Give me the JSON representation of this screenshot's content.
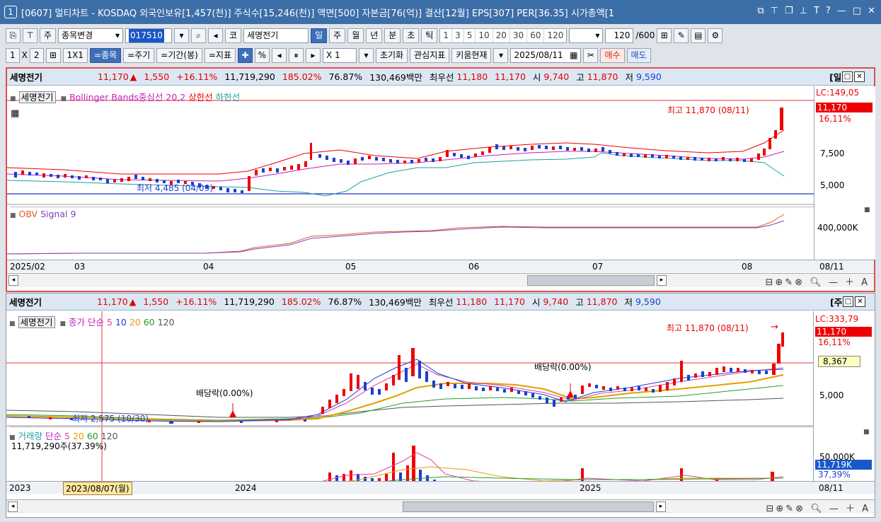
{
  "window": {
    "num": "1",
    "title": "[0607] 멀티차트 - KOSDAQ 외국인보유[1,457(천)] 주식수[15,246(천)] 액면[500] 자본금[76(억)] 결산[12월] EPS[307] PER[36.35] 시가총액[1"
  },
  "toolbar1": {
    "market": "주",
    "combo": "종목변경",
    "code": "017510",
    "market2": "코",
    "stock_name": "세명전기",
    "periods": [
      "일",
      "주",
      "월",
      "년",
      "분",
      "초",
      "틱"
    ],
    "nums": [
      "1",
      "3",
      "5",
      "10",
      "20",
      "30",
      "60",
      "120"
    ],
    "count": "120",
    "total": "/600"
  },
  "toolbar2": {
    "one": "1",
    "x": "X",
    "two": "2",
    "layout": "1X1",
    "b1": "=종목",
    "b2": "=주기",
    "b3": "=기간(봉)",
    "b4": "=지표",
    "mult": "X 1",
    "reset": "초기화",
    "interest": "관심지표",
    "kiwoom": "키움현재",
    "date": "2025/08/11",
    "buy": "매수",
    "sell": "매도"
  },
  "panel1": {
    "info": {
      "name": "세명전기",
      "price": "11,170",
      "arrow": "▲",
      "change": "1,550",
      "pct": "+16.11%",
      "volume": "11,719,290",
      "vr": "185.02%",
      "turn": "76.87%",
      "amount": "130,469백만",
      "best_label": "최우선",
      "best1": "11,180",
      "best2": "11,170",
      "open_l": "시",
      "open": "9,740",
      "high_l": "고",
      "high": "11,870",
      "low_l": "저",
      "low": "9,590",
      "period": "[일]"
    },
    "legend": {
      "name": "세명전기",
      "ind": "Bollinger Bands중심선 20,2",
      "up": "상한선",
      "down": "하한선"
    },
    "tags": {
      "high": "최고 11,870 (08/11)",
      "low": "최저 4,485 (04/09)"
    },
    "axis": {
      "lc": "LC:149,05",
      "cur": "11,170",
      "cur_pct": "16,11%",
      "l1": "7,500",
      "l2": "5,000",
      "obv": "400,000K"
    },
    "legend2": {
      "a": "OBV",
      "b": "Signal 9"
    },
    "dates": [
      "2025/02",
      "03",
      "04",
      "05",
      "06",
      "07",
      "08"
    ],
    "date_right": "08/11"
  },
  "panel2": {
    "info": {
      "name": "세명전기",
      "price": "11,170",
      "arrow": "▲",
      "change": "1,550",
      "pct": "+16.11%",
      "volume": "11,719,290",
      "vr": "185.02%",
      "turn": "76.87%",
      "amount": "130,469백만",
      "best_label": "최우선",
      "best1": "11,180",
      "best2": "11,170",
      "open_l": "시",
      "open": "9,740",
      "high_l": "고",
      "high": "11,870",
      "low_l": "저",
      "low": "9,590",
      "period": "[주]"
    },
    "legend": {
      "name": "세명전기",
      "a": "종가",
      "b": "단순",
      "m5": "5",
      "m10": "10",
      "m20": "20",
      "m60": "60",
      "m120": "120"
    },
    "tags": {
      "high": "최고 11,870 (08/11)",
      "low": "최저 2,575 (10/30)",
      "div1": "배당락(0.00%)",
      "div2": "배당락(0.00%)"
    },
    "axis": {
      "lc": "LC:333,79",
      "cur": "11,170",
      "cur_pct": "16,11%",
      "cross": "8,367",
      "l1": "5,000",
      "vol": "50,000K",
      "vol_cur": "11,719K",
      "vol_pct": "37,39%"
    },
    "vol_legend": {
      "a": "거래량",
      "b": "단순",
      "m5": "5",
      "m20": "20",
      "m60": "60",
      "m120": "120",
      "info": "11,719,290주(37.39%)"
    },
    "dates": [
      "2023",
      "2023/08/07(월)",
      "2024",
      "2025"
    ],
    "date_right": "08/11"
  },
  "colors": {
    "red": "#e00000",
    "blue": "#1a3fd0",
    "title": "#3c6ea8"
  }
}
